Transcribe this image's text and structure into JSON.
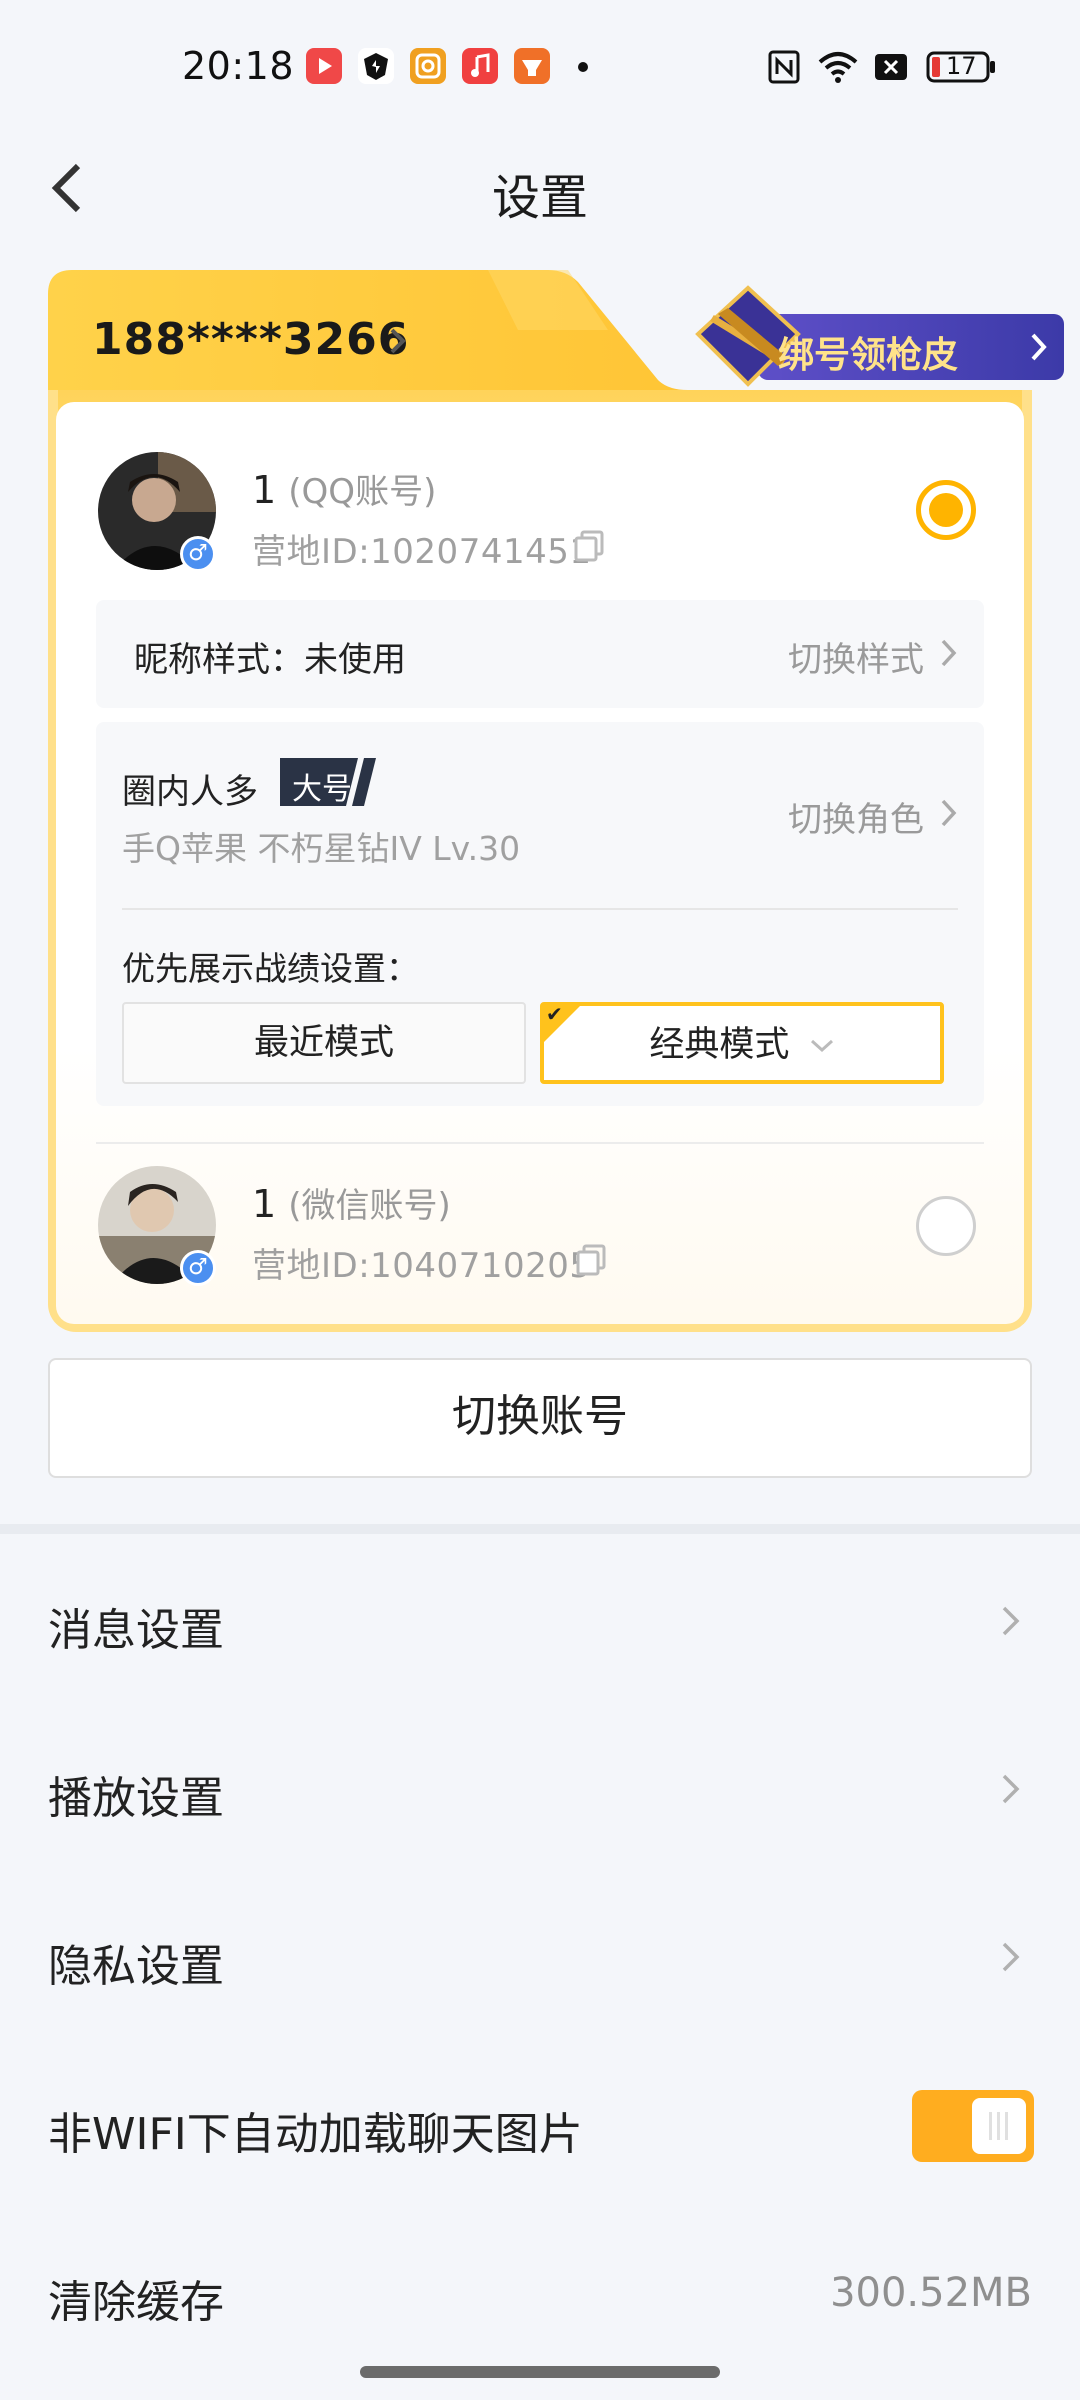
{
  "status_bar": {
    "time": "20:18",
    "battery": "17",
    "icons": [
      "video-app-icon",
      "shield-app-icon",
      "camera-app-icon",
      "music-app-icon",
      "game-app-icon",
      "nfc-icon",
      "wifi-icon",
      "sim-off-icon",
      "battery-icon"
    ],
    "colors": {
      "video": "#f04848",
      "camera": "#f0a020",
      "music": "#f04040",
      "game": "#f07028"
    }
  },
  "header": {
    "title": "设置"
  },
  "account_card": {
    "phone": "188****3266",
    "promo_label": "绑号领枪皮",
    "accounts": [
      {
        "name": "1",
        "type": "(QQ账号)",
        "id": "营地ID:1020741451",
        "selected": true
      },
      {
        "name": "1",
        "type": "(微信账号)",
        "id": "营地ID:1040710205",
        "selected": false
      }
    ],
    "nickname_style_label": "昵称样式：未使用",
    "nickname_style_action": "切换样式",
    "role": {
      "name": "圈内人多",
      "tag": "大号",
      "meta": "手Q苹果  不朽星钻IV  Lv.30",
      "action": "切换角色"
    },
    "pref_label": "优先展示战绩设置：",
    "mode_recent": "最近模式",
    "mode_classic": "经典模式",
    "gender_symbol": "♂"
  },
  "switch_account_label": "切换账号",
  "settings": {
    "message": "消息设置",
    "playback": "播放设置",
    "privacy": "隐私设置",
    "autoload": "非WIFI下自动加载聊天图片",
    "autoload_on": true,
    "clear_cache": "清除缓存",
    "cache_size": "300.52MB"
  },
  "colors": {
    "accent": "#ffb400",
    "card_gradient_top": "#ffd35a",
    "promo_bg": "#4a44b8"
  }
}
